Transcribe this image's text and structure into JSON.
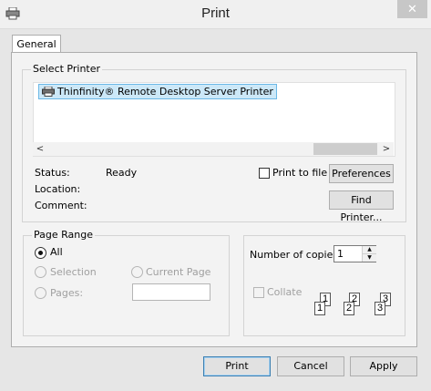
{
  "window": {
    "title": "Print",
    "close_glyph": "✕"
  },
  "tabs": [
    {
      "label": "General",
      "selected": true
    }
  ],
  "select_printer": {
    "group_label": "Select Printer",
    "printers": [
      {
        "name": "Thinfinity® Remote Desktop Server Printer",
        "selected": true
      }
    ],
    "scroll_left": "<",
    "scroll_right": ">"
  },
  "printer_info": {
    "status_label": "Status:",
    "status_value": "Ready",
    "location_label": "Location:",
    "location_value": "",
    "comment_label": "Comment:",
    "comment_value": ""
  },
  "print_to_file": {
    "label": "Print to file",
    "checked": false
  },
  "buttons": {
    "preferences": "Preferences",
    "find_printer": "Find Printer...",
    "print": "Print",
    "cancel": "Cancel",
    "apply": "Apply"
  },
  "page_range": {
    "group_label": "Page Range",
    "all_label": "All",
    "selection_label": "Selection",
    "current_page_label": "Current Page",
    "pages_label": "Pages:",
    "pages_value": "",
    "selected": "all"
  },
  "copies": {
    "label": "Number of copies:",
    "value": "1",
    "collate_label": "Collate",
    "collate_checked": false,
    "collate_pages": [
      "1",
      "1",
      "2",
      "2",
      "3",
      "3"
    ]
  },
  "colors": {
    "selection_bg": "#cce8f8",
    "selection_border": "#6bb8e6",
    "close_btn": "#c7c7c7"
  }
}
